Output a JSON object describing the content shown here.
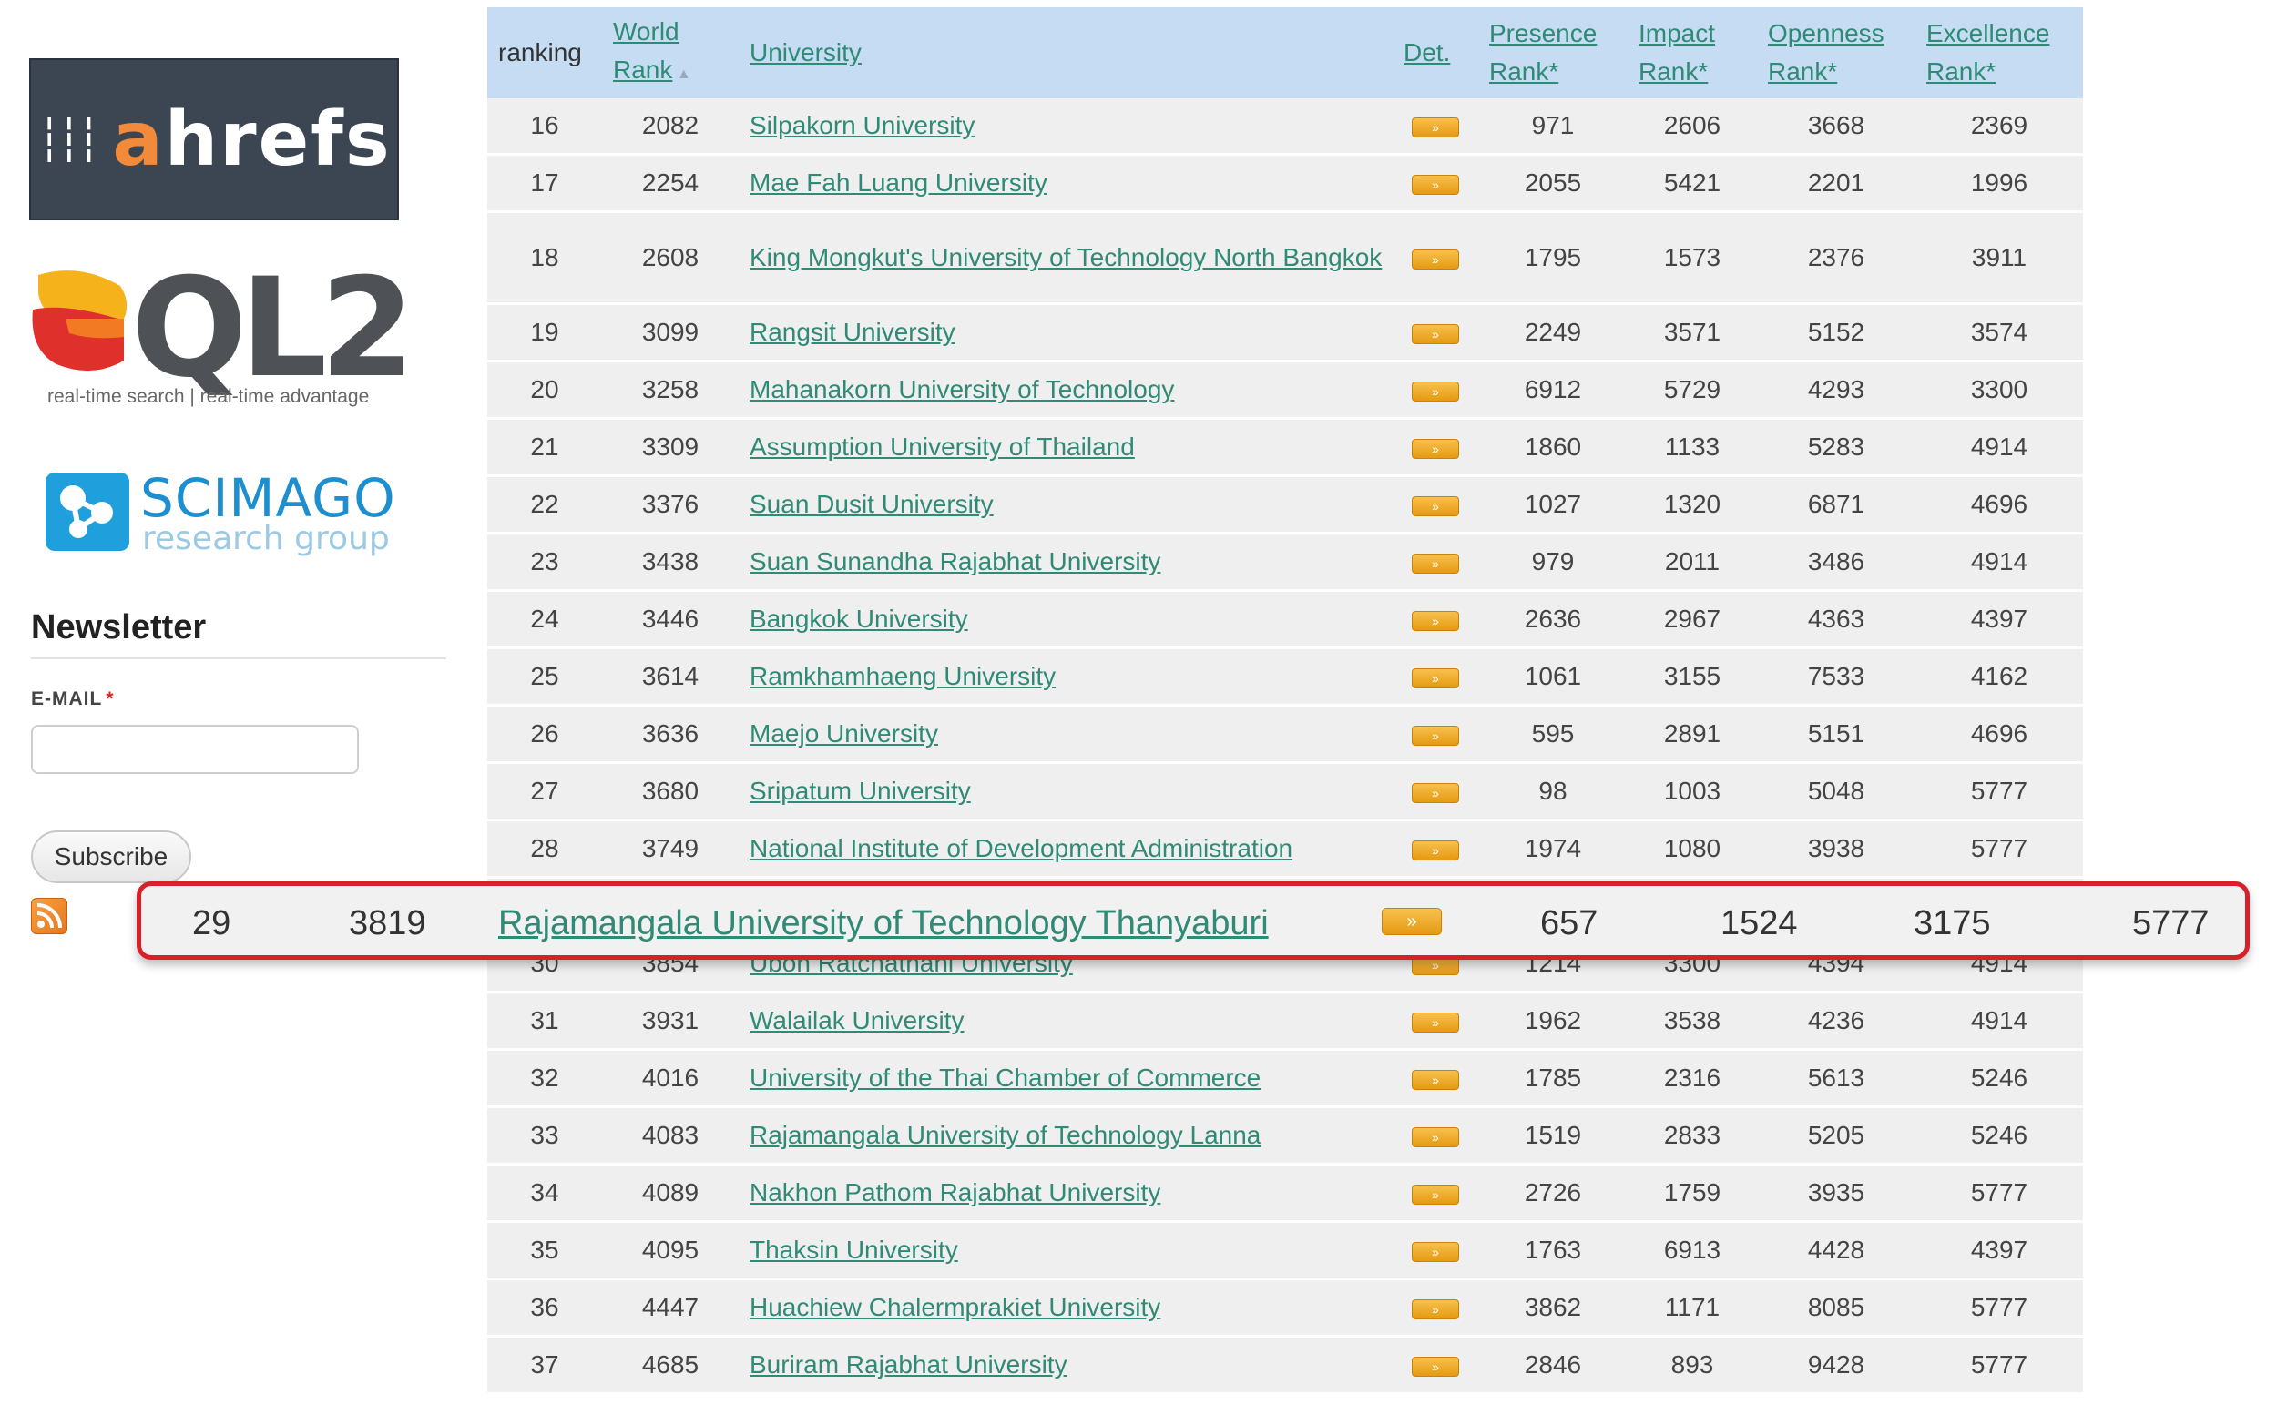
{
  "sidebar": {
    "ahrefs_logo": "ahrefs",
    "ql2_logo": "QL2",
    "ql2_tagline": "real-time search | real-time advantage",
    "scimago_name": "SCIMAGO",
    "scimago_sub": "research group",
    "newsletter_title": "Newsletter",
    "email_label": "E-MAIL",
    "email_required": "*",
    "email_value": "",
    "subscribe_label": "Subscribe",
    "rss_icon": "rss-icon"
  },
  "table": {
    "headers": {
      "ranking": "ranking",
      "world_rank_1": "World",
      "world_rank_2": "Rank",
      "university": "University",
      "det": "Det.",
      "presence_1": "Presence",
      "presence_2": "Rank*",
      "impact_1": "Impact",
      "impact_2": "Rank*",
      "openness_1": "Openness",
      "openness_2": "Rank*",
      "excellence_1": "Excellence",
      "excellence_2": "Rank*"
    },
    "det_icon_text": "»",
    "rows": [
      {
        "ranking": "16",
        "world": "2082",
        "name": "Silpakorn University",
        "presence": "971",
        "impact": "2606",
        "openness": "3668",
        "excellence": "2369"
      },
      {
        "ranking": "17",
        "world": "2254",
        "name": "Mae Fah Luang University",
        "presence": "2055",
        "impact": "5421",
        "openness": "2201",
        "excellence": "1996"
      },
      {
        "ranking": "18",
        "world": "2608",
        "name": "King Mongkut's University of Technology North Bangkok",
        "presence": "1795",
        "impact": "1573",
        "openness": "2376",
        "excellence": "3911"
      },
      {
        "ranking": "19",
        "world": "3099",
        "name": "Rangsit University",
        "presence": "2249",
        "impact": "3571",
        "openness": "5152",
        "excellence": "3574"
      },
      {
        "ranking": "20",
        "world": "3258",
        "name": "Mahanakorn University of Technology",
        "presence": "6912",
        "impact": "5729",
        "openness": "4293",
        "excellence": "3300"
      },
      {
        "ranking": "21",
        "world": "3309",
        "name": "Assumption University of Thailand",
        "presence": "1860",
        "impact": "1133",
        "openness": "5283",
        "excellence": "4914"
      },
      {
        "ranking": "22",
        "world": "3376",
        "name": "Suan Dusit University",
        "presence": "1027",
        "impact": "1320",
        "openness": "6871",
        "excellence": "4696"
      },
      {
        "ranking": "23",
        "world": "3438",
        "name": "Suan Sunandha Rajabhat University",
        "presence": "979",
        "impact": "2011",
        "openness": "3486",
        "excellence": "4914"
      },
      {
        "ranking": "24",
        "world": "3446",
        "name": "Bangkok University",
        "presence": "2636",
        "impact": "2967",
        "openness": "4363",
        "excellence": "4397"
      },
      {
        "ranking": "25",
        "world": "3614",
        "name": "Ramkhamhaeng University",
        "presence": "1061",
        "impact": "3155",
        "openness": "7533",
        "excellence": "4162"
      },
      {
        "ranking": "26",
        "world": "3636",
        "name": "Maejo University",
        "presence": "595",
        "impact": "2891",
        "openness": "5151",
        "excellence": "4696"
      },
      {
        "ranking": "27",
        "world": "3680",
        "name": "Sripatum University",
        "presence": "98",
        "impact": "1003",
        "openness": "5048",
        "excellence": "5777"
      },
      {
        "ranking": "28",
        "world": "3749",
        "name": "National Institute of Development Administration",
        "presence": "1974",
        "impact": "1080",
        "openness": "3938",
        "excellence": "5777"
      },
      {
        "ranking": "29",
        "world": "3819",
        "name": "Rajamangala University of Technology Thanyaburi",
        "presence": "657",
        "impact": "1524",
        "openness": "3175",
        "excellence": "5777"
      },
      {
        "ranking": "30",
        "world": "3854",
        "name": "Ubon Ratchathani University",
        "presence": "1214",
        "impact": "3300",
        "openness": "4394",
        "excellence": "4914"
      },
      {
        "ranking": "31",
        "world": "3931",
        "name": "Walailak University",
        "presence": "1962",
        "impact": "3538",
        "openness": "4236",
        "excellence": "4914"
      },
      {
        "ranking": "32",
        "world": "4016",
        "name": "University of the Thai Chamber of Commerce",
        "presence": "1785",
        "impact": "2316",
        "openness": "5613",
        "excellence": "5246"
      },
      {
        "ranking": "33",
        "world": "4083",
        "name": "Rajamangala University of Technology Lanna",
        "presence": "1519",
        "impact": "2833",
        "openness": "5205",
        "excellence": "5246"
      },
      {
        "ranking": "34",
        "world": "4089",
        "name": "Nakhon Pathom Rajabhat University",
        "presence": "2726",
        "impact": "1759",
        "openness": "3935",
        "excellence": "5777"
      },
      {
        "ranking": "35",
        "world": "4095",
        "name": "Thaksin University",
        "presence": "1763",
        "impact": "6913",
        "openness": "4428",
        "excellence": "4397"
      },
      {
        "ranking": "36",
        "world": "4447",
        "name": "Huachiew Chalermprakiet University",
        "presence": "3862",
        "impact": "1171",
        "openness": "8085",
        "excellence": "5777"
      },
      {
        "ranking": "37",
        "world": "4685",
        "name": "Buriram Rajabhat University",
        "presence": "2846",
        "impact": "893",
        "openness": "9428",
        "excellence": "5777"
      }
    ]
  },
  "highlight": {
    "ranking": "29",
    "world": "3819",
    "name": "Rajamangala University of Technology Thanyaburi",
    "det": "»",
    "presence": "657",
    "impact": "1524",
    "openness": "3175",
    "excellence": "5777"
  },
  "colors": {
    "header_bg": "#c5dcf2",
    "link": "#2f8a76",
    "row_bg": "#efefef",
    "highlight_border": "#d8202a"
  }
}
